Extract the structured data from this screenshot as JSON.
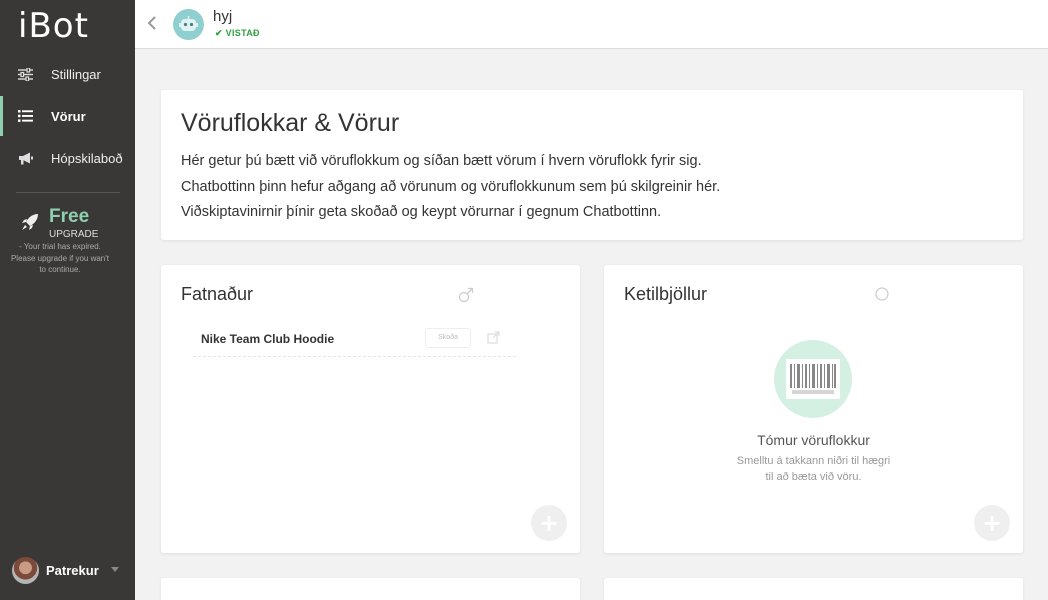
{
  "app": {
    "logo": "iBot"
  },
  "sidebar": {
    "items": [
      {
        "label": "Stillingar",
        "icon": "sliders-icon"
      },
      {
        "label": "Vörur",
        "icon": "list-icon",
        "active": true
      },
      {
        "label": "Hópskilaboð",
        "icon": "megaphone-icon"
      }
    ],
    "plan": {
      "name": "Free",
      "action": "UPGRADE",
      "note": "- Your trial has expired. Please upgrade if you wan't to continue."
    },
    "user": {
      "name": "Patrekur"
    }
  },
  "header": {
    "bot_name": "hyj",
    "status": "VISTAÐ"
  },
  "intro": {
    "title": "Vöruflokkar & Vörur",
    "lines": [
      "Hér getur þú bætt við vöruflokkum og síðan bætt vörum í hvern vöruflokk fyrir sig.",
      "Chatbottinn þinn hefur aðgang að vörunum og vöruflokkunum sem þú skilgreinir hér.",
      "Viðskiptavinirnir þínir geta skoðað og keypt vörurnar í gegnum Chatbottinn."
    ]
  },
  "categories": [
    {
      "name": "Fatnaður",
      "icon": "male-icon",
      "products": [
        {
          "name": "Nike Team Club Hoodie",
          "view_label": "Skoða"
        }
      ]
    },
    {
      "name": "Ketilbjöllur",
      "icon": "circle-icon",
      "empty": {
        "title": "Tómur vöruflokkur",
        "hint_line1": "Smelltu á takkann niðri til hægri",
        "hint_line2": "til að bæta við vöru."
      }
    }
  ],
  "colors": {
    "sidebar": "#3a3837",
    "accent": "#8fd0b0",
    "saved": "#2ea043"
  }
}
